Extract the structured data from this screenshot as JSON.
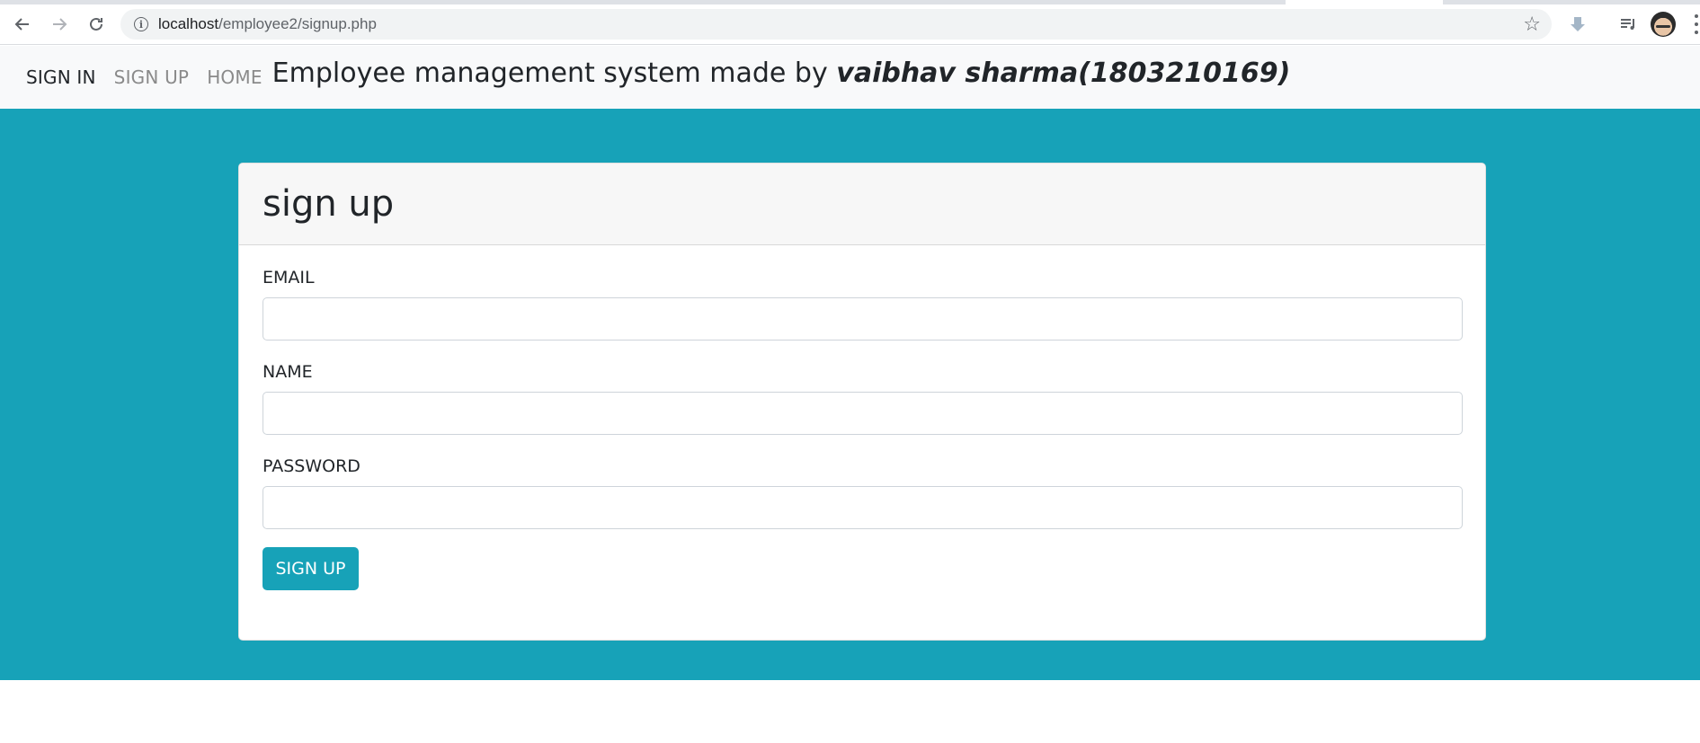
{
  "browser": {
    "url_host": "localhost",
    "url_path": "/employee2/signup.php"
  },
  "navbar": {
    "links": [
      {
        "label": "SIGN IN"
      },
      {
        "label": "SIGN UP"
      },
      {
        "label": "HOME"
      }
    ],
    "brand_prefix": "Employee management system made by ",
    "brand_author": "vaibhav sharma(1803210169)"
  },
  "form": {
    "title": "sign up",
    "fields": [
      {
        "label": "EMAIL",
        "value": "",
        "placeholder": ""
      },
      {
        "label": "NAME",
        "value": "",
        "placeholder": ""
      },
      {
        "label": "PASSWORD",
        "value": "",
        "placeholder": ""
      }
    ],
    "submit_label": "SIGN UP"
  },
  "colors": {
    "accent": "#17a2b8",
    "navbar_bg": "#f8f9fa",
    "card_header_bg": "#f7f7f7"
  },
  "icons": {
    "back": "back-arrow-icon",
    "forward": "forward-arrow-icon",
    "reload": "reload-icon",
    "info": "info-icon",
    "bookmark": "star-icon",
    "download": "download-icon",
    "playlist": "media-queue-icon",
    "menu": "menu-dots-icon"
  }
}
